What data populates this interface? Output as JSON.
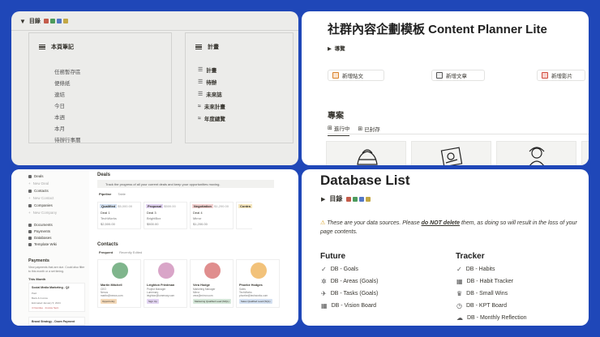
{
  "panel1": {
    "toggle": "▼",
    "header": "目錄",
    "dot_colors": [
      "#c45b4a",
      "#4c9b5c",
      "#5478c6",
      "#c3a744"
    ],
    "left_box": {
      "title": "本頁筆記",
      "items": [
        "任務暫存區",
        "便條紙",
        "連結",
        "今日",
        "本週",
        "本月",
        "待辦行事曆"
      ]
    },
    "right_box": {
      "title": "計畫",
      "items": [
        {
          "icon": "plan-icon",
          "glyph": "☰",
          "label": "計畫"
        },
        {
          "icon": "todo-icon",
          "glyph": "☰",
          "label": "待辦"
        },
        {
          "icon": "future-icon",
          "glyph": "☰",
          "label": "未來誌"
        },
        {
          "icon": "future-plan-icon",
          "glyph": "≈",
          "label": "未來計畫"
        },
        {
          "icon": "annual-icon",
          "glyph": "≈",
          "label": "年度總覽"
        }
      ]
    }
  },
  "panel2": {
    "title": "社群內容企劃模板 Content Planner Lite",
    "guide": "導覽",
    "buttons": [
      {
        "label": "新增貼文",
        "color": "#d9822b"
      },
      {
        "label": "新增文章",
        "color": "#555555"
      },
      {
        "label": "新增影片",
        "color": "#d24b3e"
      }
    ],
    "projects_heading": "專案",
    "tabs": [
      "進行中",
      "已封存"
    ]
  },
  "panel3": {
    "sidebar": {
      "items": [
        {
          "label": "Deals",
          "muted": false
        },
        {
          "label": "New Deal",
          "muted": true
        },
        {
          "label": "Contacts",
          "muted": false
        },
        {
          "label": "New Contact",
          "muted": true
        },
        {
          "label": "Companies",
          "muted": false
        },
        {
          "label": "New Company",
          "muted": true
        },
        {
          "label": "Documents",
          "muted": false
        },
        {
          "label": "Payments",
          "muted": false
        },
        {
          "label": "Databases",
          "muted": false
        },
        {
          "label": "Template Wiki",
          "muted": false
        }
      ],
      "payments_heading": "Payments",
      "payments_desc": "View payments that are due. Could also filter to this month or a set timing.",
      "this_month": "This Month",
      "pay1_title": "Social Media Marketing - Q2",
      "pay1_lines": [
        "Paid",
        "Bank & Invoice",
        "Estimated January 5, 2024",
        "4 Overdue · Invoice Sent"
      ],
      "pay2_title": "Brand Strategy - Down Payment"
    },
    "deals_heading": "Deals",
    "callout": "Track the progress of all your current deals and keep your opportunities moving.",
    "view_tabs": [
      "Pipeline",
      "Table"
    ],
    "stages": [
      {
        "name": "Qualified",
        "total": "$5,000.00",
        "color": "#4a7fbf",
        "deal": "Deal 1",
        "owner": "TechWorks",
        "value": "$2,500.00"
      },
      {
        "name": "Proposal",
        "total": "$500.00",
        "color": "#8a5cc9",
        "deal": "Deal 3",
        "owner": "BrightBox",
        "value": "$500.00"
      },
      {
        "name": "Negotiation",
        "total": "$1,200.00",
        "color": "#c25252",
        "deal": "Deal 4",
        "owner": "Mirror",
        "value": "$1,200.00"
      },
      {
        "name": "Contra",
        "total": "",
        "color": "#c9a13a",
        "deal": "",
        "owner": "",
        "value": ""
      }
    ],
    "contacts_heading": "Contacts",
    "contact_tabs": [
      "Frequent",
      "Recently Edited"
    ],
    "contacts": [
      {
        "name": "Martin Mitchell",
        "role": "CEO",
        "company": "Nexus",
        "email": "martin@nexus.com",
        "tag": "Opportunity",
        "tag_color": "#f4d9b8",
        "avatar": "#7fb58c"
      },
      {
        "name": "Leighton Friedman",
        "role": "Project Manager",
        "company": "Lumenary",
        "email": "leighton@lumenary.com",
        "tag": "Sign Up",
        "tag_color": "#e1d3f1",
        "avatar": "#d9a5c8"
      },
      {
        "name": "Vera Hodge",
        "role": "Marketing Manager",
        "company": "Mirror",
        "email": "vera@mirror.com",
        "tag": "Marketing Qualified Lead (MQL)",
        "tag_color": "#d4e6d8",
        "avatar": "#e08e8e"
      },
      {
        "name": "Phoebe Hodges",
        "role": "Sales",
        "company": "TechWorks",
        "email": "phoebe@techworks.com",
        "tag": "Sales Qualified Lead (SQL)",
        "tag_color": "#d3e0f1",
        "avatar": "#f2c27a"
      }
    ]
  },
  "panel4": {
    "title": "Database List",
    "header": "目錄",
    "warning_pre": "These are your data sources. Please ",
    "warning_bold": "do NOT delete",
    "warning_post": " them, as doing so will result in the loss of your page contents.",
    "future_title": "Future",
    "future_items": [
      {
        "glyph": "✓",
        "label": "DB - Goals"
      },
      {
        "glyph": "✲",
        "label": "DB - Areas (Goals)"
      },
      {
        "glyph": "✈",
        "label": "DB - Tasks (Goals)"
      },
      {
        "glyph": "▦",
        "label": "DB - Vision Board"
      }
    ],
    "tracker_title": "Tracker",
    "tracker_items": [
      {
        "glyph": "✓",
        "label": "DB - Habits"
      },
      {
        "glyph": "▦",
        "label": "DB - Habit Tracker"
      },
      {
        "glyph": "♛",
        "label": "DB - Small Wins"
      },
      {
        "glyph": "◷",
        "label": "DB - KPT Board"
      },
      {
        "glyph": "☁",
        "label": "DB - Monthly Reflection"
      }
    ]
  }
}
